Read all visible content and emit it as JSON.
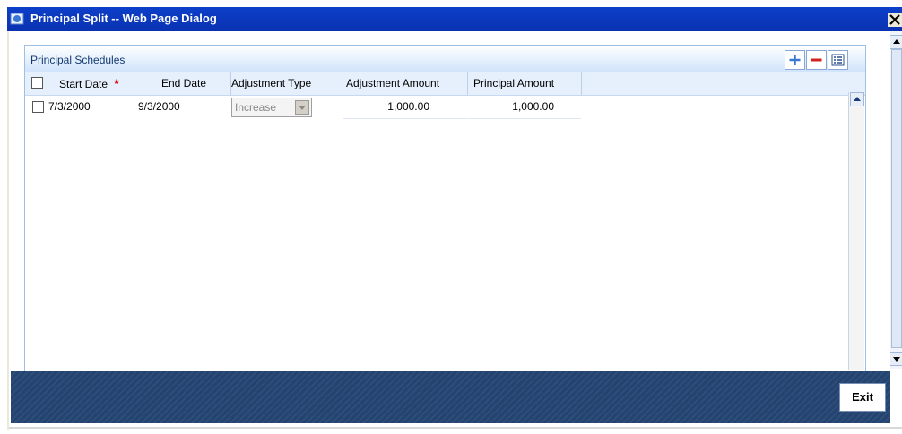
{
  "window": {
    "title": "Principal Split -- Web Page Dialog",
    "close_glyph": "x",
    "icon": "ie-dialog-icon"
  },
  "panel": {
    "title": "Principal Schedules",
    "toolbar": [
      {
        "name": "add-row-button",
        "icon": "plus-icon"
      },
      {
        "name": "delete-row-button",
        "icon": "minus-icon"
      },
      {
        "name": "single-view-button",
        "icon": "list-icon"
      }
    ]
  },
  "grid": {
    "columns": [
      "Start Date",
      "End Date",
      "Adjustment Type",
      "Adjustment Amount",
      "Principal Amount"
    ],
    "required_marker": "*",
    "rows": [
      {
        "start_date": "7/3/2000",
        "end_date": "9/3/2000",
        "adjustment_type": "Increase",
        "adjustment_amount": "1,000.00",
        "principal_amount": "1,000.00"
      }
    ]
  },
  "footer": {
    "exit_label": "Exit"
  },
  "colors": {
    "title_bar": "#0c3fc9",
    "footer": "#24436e",
    "required": "#d40000",
    "add_icon": "#3a78d6",
    "remove_icon": "#d42020"
  }
}
